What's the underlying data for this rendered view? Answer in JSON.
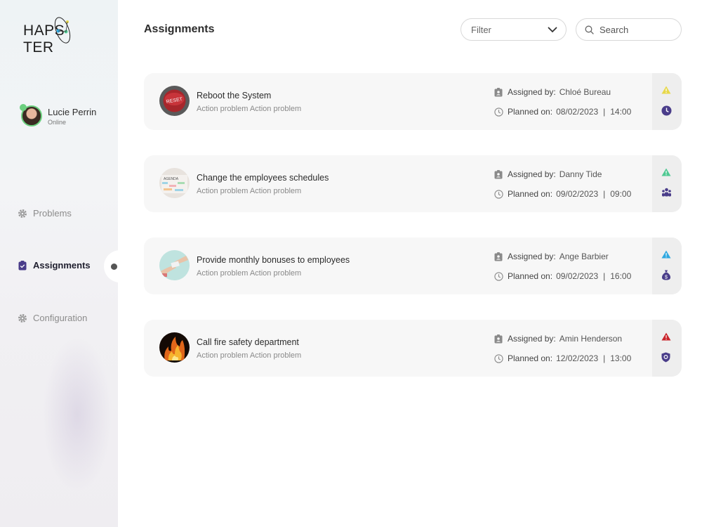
{
  "app": {
    "logo_left": "HAPS",
    "logo_right": "TER"
  },
  "user": {
    "name": "Lucie Perrin",
    "status": "Online"
  },
  "nav": {
    "problems": "Problems",
    "assignments": "Assignments",
    "configuration": "Configuration"
  },
  "header": {
    "title": "Assignments",
    "filter_label": "Filter",
    "search_placeholder": "Search"
  },
  "colors": {
    "priority_yellow": "#e7d84a",
    "priority_green": "#4fc992",
    "priority_blue": "#2fa8e0",
    "priority_red": "#c9242b",
    "icon_purple": "#4a3d8a"
  },
  "assignments": [
    {
      "title": "Reboot the System",
      "subtitle": "Action problem Action problem",
      "assigned_label": "Assigned by:",
      "assigned_by": "Chloé Bureau",
      "planned_label": "Planned on:",
      "planned_date": "08/02/2023",
      "separator": "|",
      "planned_time": "14:00",
      "priority_icon": "warning-triangle-icon",
      "category_icon": "clock-icon"
    },
    {
      "title": "Change the employees schedules",
      "subtitle": "Action problem Action problem",
      "assigned_label": "Assigned by:",
      "assigned_by": "Danny Tide",
      "planned_label": "Planned on:",
      "planned_date": "09/02/2023",
      "separator": "|",
      "planned_time": "09:00",
      "priority_icon": "warning-triangle-icon",
      "category_icon": "people-icon"
    },
    {
      "title": "Provide monthly bonuses to employees",
      "subtitle": "Action problem Action problem",
      "assigned_label": "Assigned by:",
      "assigned_by": "Ange Barbier",
      "planned_label": "Planned on:",
      "planned_date": "09/02/2023",
      "separator": "|",
      "planned_time": "16:00",
      "priority_icon": "warning-triangle-icon",
      "category_icon": "money-bag-icon"
    },
    {
      "title": "Call fire safety department",
      "subtitle": "Action problem Action problem",
      "assigned_label": "Assigned by:",
      "assigned_by": "Amin Henderson",
      "planned_label": "Planned on:",
      "planned_date": "12/02/2023",
      "separator": "|",
      "planned_time": "13:00",
      "priority_icon": "warning-triangle-icon",
      "category_icon": "shield-icon"
    }
  ]
}
